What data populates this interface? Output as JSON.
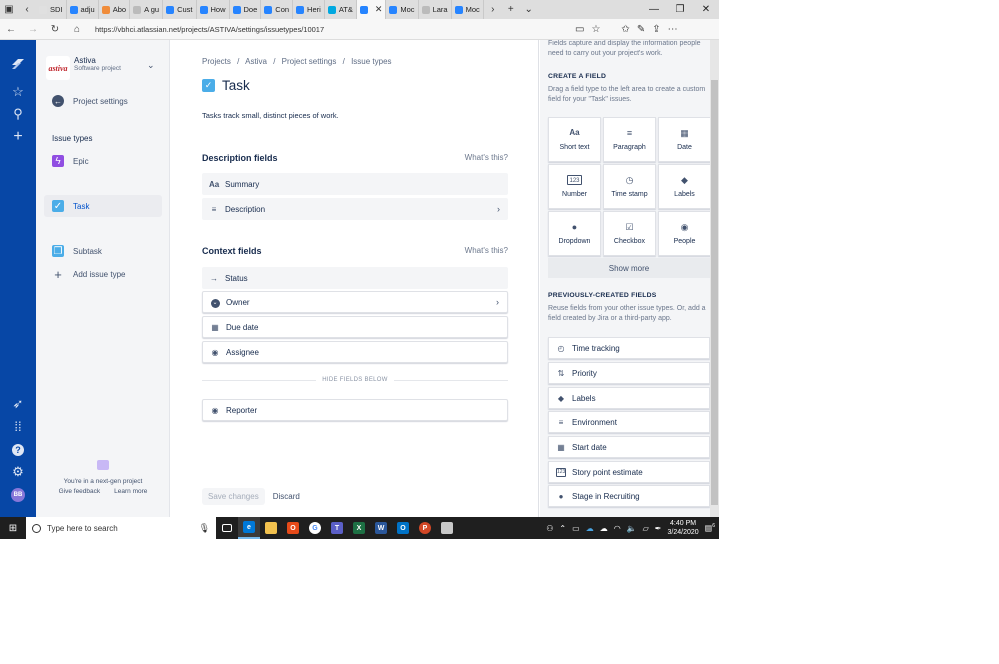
{
  "browser": {
    "tabs": [
      {
        "label": "SDI",
        "color": "#e0e0e0"
      },
      {
        "label": "adju",
        "color": "#2684ff"
      },
      {
        "label": "Abo",
        "color": "#f08c3a"
      },
      {
        "label": "A gu",
        "color": "#bbbbbb"
      },
      {
        "label": "Cust",
        "color": "#2684ff"
      },
      {
        "label": "How",
        "color": "#2684ff"
      },
      {
        "label": "Doe",
        "color": "#2684ff"
      },
      {
        "label": "Con",
        "color": "#2684ff"
      },
      {
        "label": "Heri",
        "color": "#2684ff"
      },
      {
        "label": "AT&",
        "color": "#00a8e0"
      },
      {
        "label": "",
        "color": "#2684ff"
      },
      {
        "label": "Moc",
        "color": "#2684ff"
      },
      {
        "label": "Lara",
        "color": "#bbbbbb"
      },
      {
        "label": "Moc",
        "color": "#2684ff"
      }
    ],
    "url": "https://vbhci.atlassian.net/projects/ASTIVA/settings/issuetypes/10017"
  },
  "sidebar": {
    "project_name": "Astiva",
    "project_type": "Software project",
    "logo_text": "astiva",
    "back_label": "Project settings",
    "issue_types_heading": "Issue types",
    "items": [
      {
        "label": "Epic",
        "color": "#904ee2",
        "icon": "lightning-icon"
      },
      {
        "label": "Task",
        "color": "#4bade8",
        "icon": "checkbox-icon"
      },
      {
        "label": "Subtask",
        "color": "#4bade8",
        "icon": "subtask-icon"
      }
    ],
    "add_label": "Add issue type",
    "footer_text": "You're in a next-gen project",
    "feedback_label": "Give feedback",
    "learn_label": "Learn more"
  },
  "globalnav": {
    "avatar_initials": "BB"
  },
  "main": {
    "breadcrumb": [
      "Projects",
      "/",
      "Astiva",
      "/",
      "Project settings",
      "/",
      "Issue types"
    ],
    "title": "Task",
    "description": "Tasks track small, distinct pieces of work.",
    "description_fields": {
      "heading": "Description fields",
      "whats_this": "What's this?",
      "items": [
        {
          "label": "Summary",
          "icon": "text-aa-icon"
        },
        {
          "label": "Description",
          "icon": "lines-icon"
        }
      ]
    },
    "context_fields": {
      "heading": "Context fields",
      "whats_this": "What's this?",
      "items": [
        {
          "label": "Status",
          "icon": "arrow-right-icon"
        },
        {
          "label": "Owner",
          "icon": "chevron-circle-icon"
        },
        {
          "label": "Due date",
          "icon": "calendar-icon"
        },
        {
          "label": "Assignee",
          "icon": "person-circle-icon"
        }
      ]
    },
    "hide_label": "HIDE FIELDS BELOW",
    "hidden_items": [
      {
        "label": "Reporter",
        "icon": "person-circle-icon"
      }
    ],
    "save_label": "Save changes",
    "discard_label": "Discard"
  },
  "right_panel": {
    "intro": "Fields capture and display the information people need to carry out your project's work.",
    "create_heading": "CREATE A FIELD",
    "create_text": "Drag a field type to the left area to create a custom field for your \"Task\" issues.",
    "field_types": [
      {
        "label": "Short text",
        "icon": "text-aa-icon"
      },
      {
        "label": "Paragraph",
        "icon": "paragraph-icon"
      },
      {
        "label": "Date",
        "icon": "calendar-icon"
      },
      {
        "label": "Number",
        "icon": "number-icon"
      },
      {
        "label": "Time stamp",
        "icon": "clock-icon"
      },
      {
        "label": "Labels",
        "icon": "tag-icon"
      },
      {
        "label": "Dropdown",
        "icon": "dropdown-icon"
      },
      {
        "label": "Checkbox",
        "icon": "checkbox-icon"
      },
      {
        "label": "People",
        "icon": "person-icon"
      }
    ],
    "show_more_label": "Show more",
    "prev_heading": "PREVIOUSLY-CREATED FIELDS",
    "prev_text": "Reuse fields from your other issue types. Or, add a field created by Jira or a third-party app.",
    "prev_fields": [
      {
        "label": "Time tracking",
        "icon": "stopwatch-icon"
      },
      {
        "label": "Priority",
        "icon": "priority-icon"
      },
      {
        "label": "Labels",
        "icon": "tag-icon"
      },
      {
        "label": "Environment",
        "icon": "lines-icon"
      },
      {
        "label": "Start date",
        "icon": "calendar-icon"
      },
      {
        "label": "Story point estimate",
        "icon": "number-icon"
      },
      {
        "label": "Stage in Recruiting",
        "icon": "dropdown-icon"
      }
    ]
  },
  "taskbar": {
    "search_placeholder": "Type here to search",
    "time": "4:40 PM",
    "date": "3/24/2020",
    "notif_count": "6"
  }
}
